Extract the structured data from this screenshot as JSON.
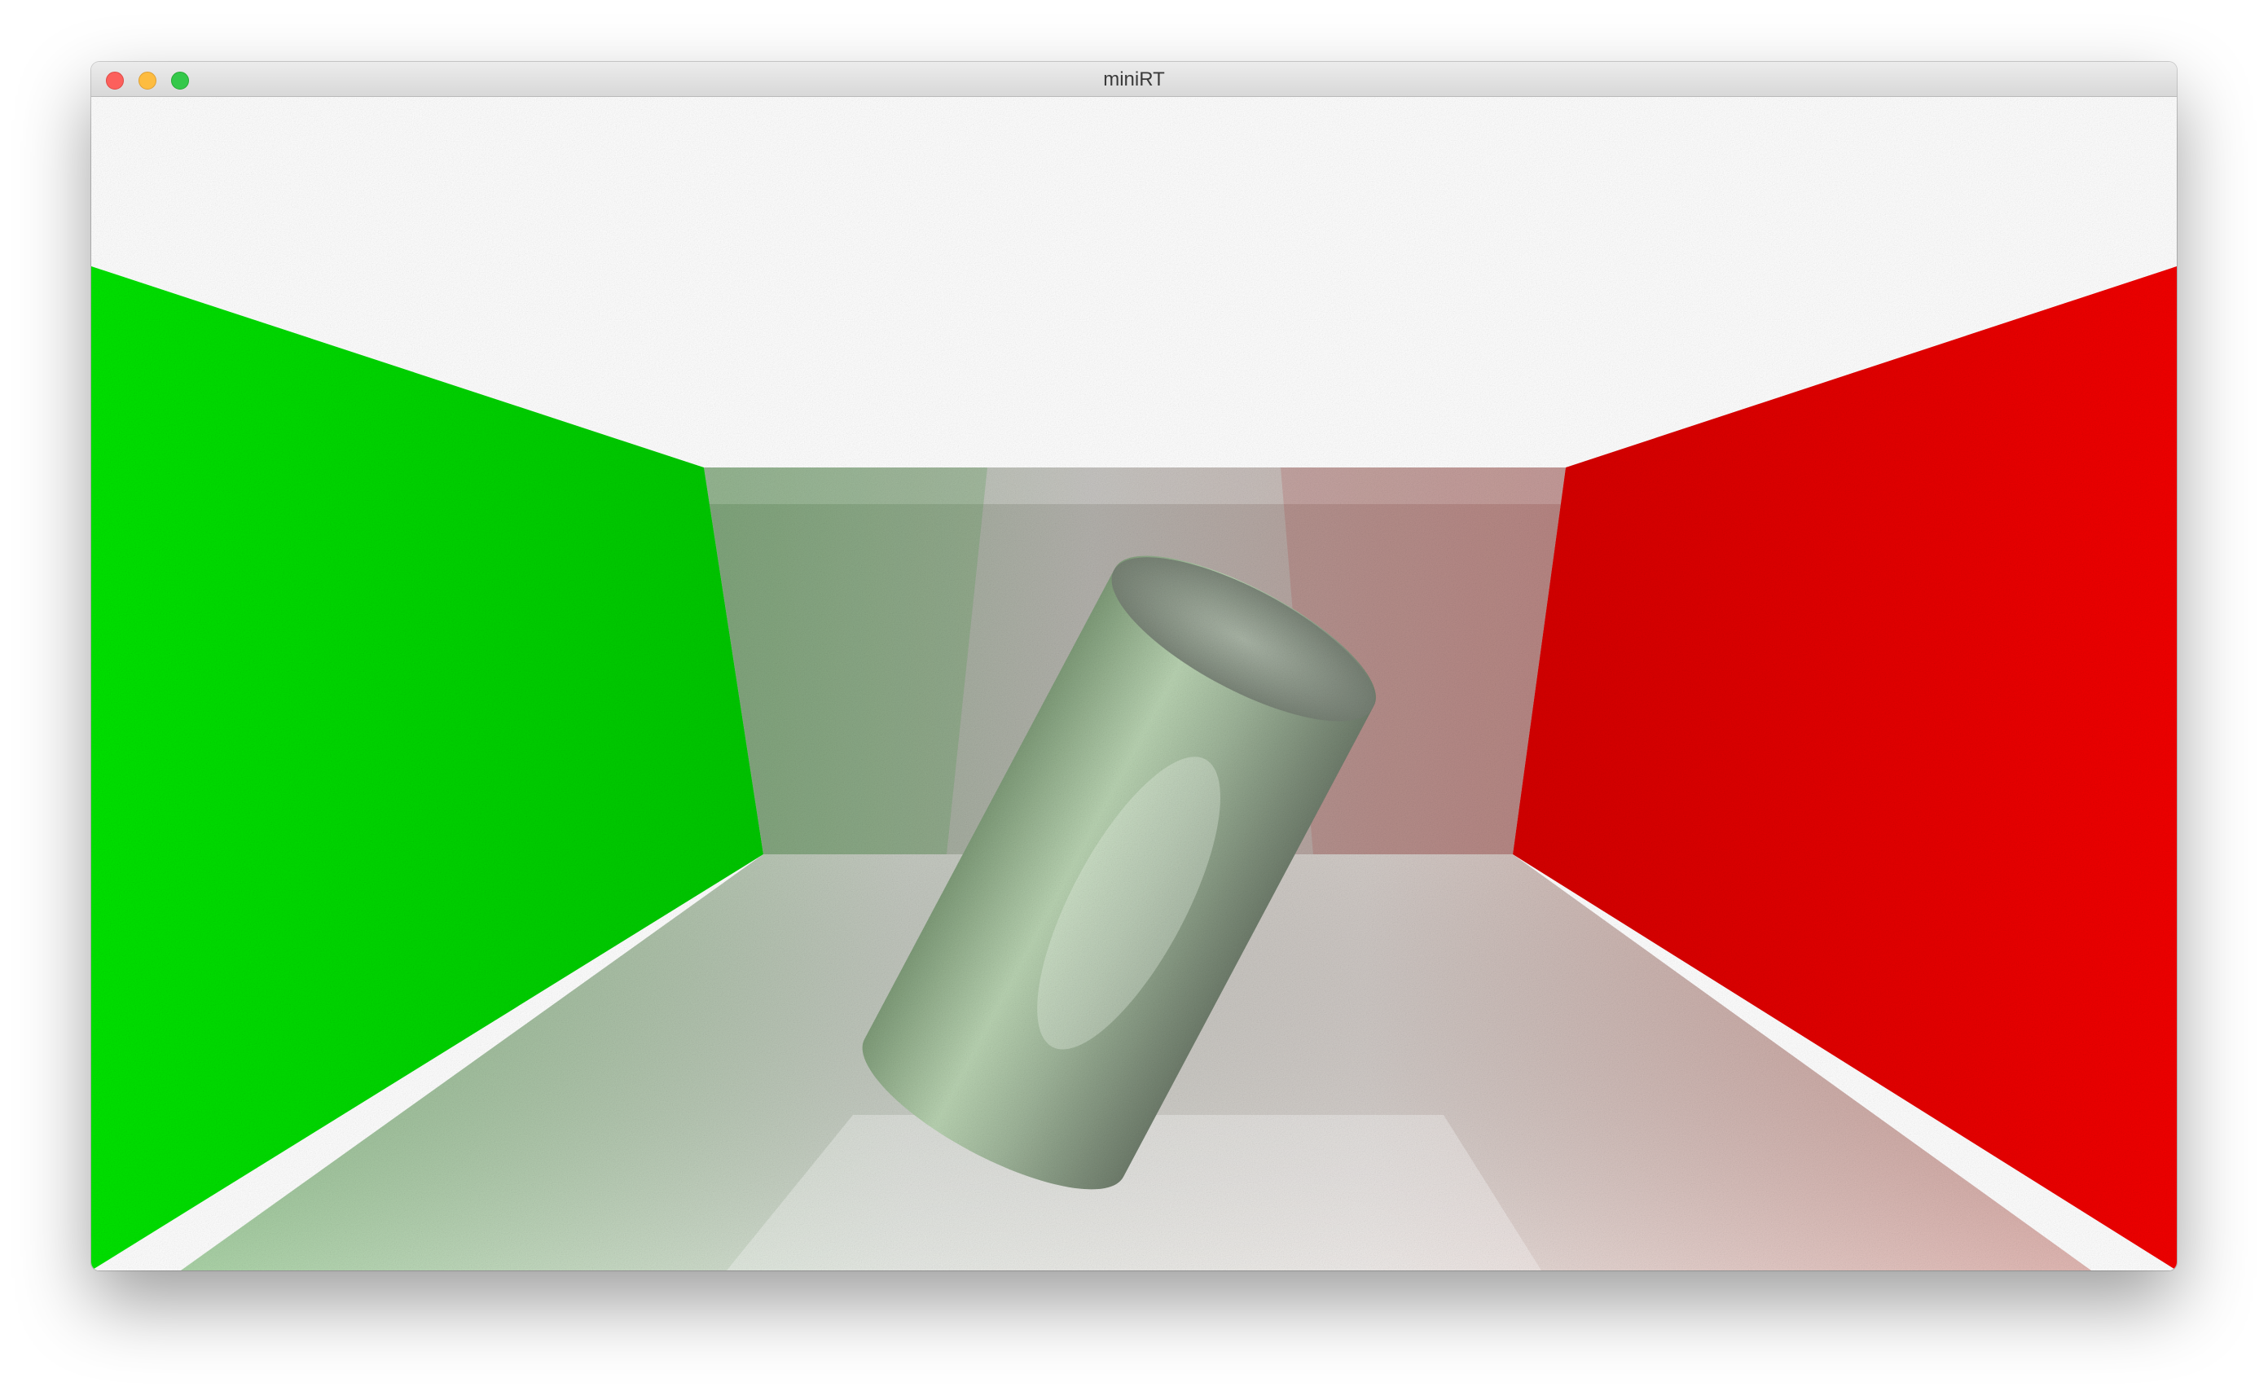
{
  "window": {
    "title": "miniRT",
    "controls": [
      "close",
      "minimize",
      "maximize"
    ]
  },
  "scene": {
    "colors": {
      "ceiling": "#ffffff",
      "left_wall": "#00d800",
      "right_wall": "#e80000",
      "back_wall": "#c9c6c0",
      "floor": "#d9d4cf",
      "cylinder": "#a9c2a2"
    }
  }
}
